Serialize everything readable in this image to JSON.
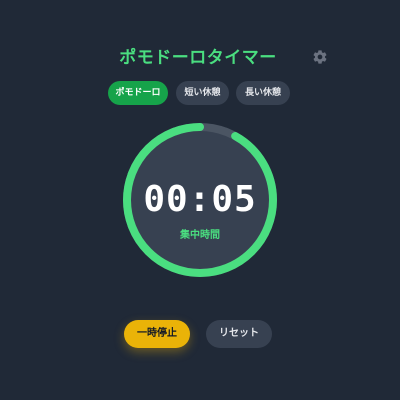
{
  "header": {
    "title": "ポモドーロタイマー",
    "settings_icon": "gear-icon"
  },
  "modes": {
    "tabs": [
      {
        "label": "ポモドーロ",
        "active": true
      },
      {
        "label": "短い休憩",
        "active": false
      },
      {
        "label": "長い休憩",
        "active": false
      }
    ]
  },
  "timer": {
    "time": "00:05",
    "phase_label": "集中時間",
    "progress_remaining": 0.92
  },
  "controls": {
    "pause_label": "一時停止",
    "reset_label": "リセット"
  },
  "colors": {
    "background": "#202937",
    "accent": "#4ade80",
    "tab_active": "#16a34a",
    "pause": "#eab308",
    "secondary": "#374151"
  }
}
